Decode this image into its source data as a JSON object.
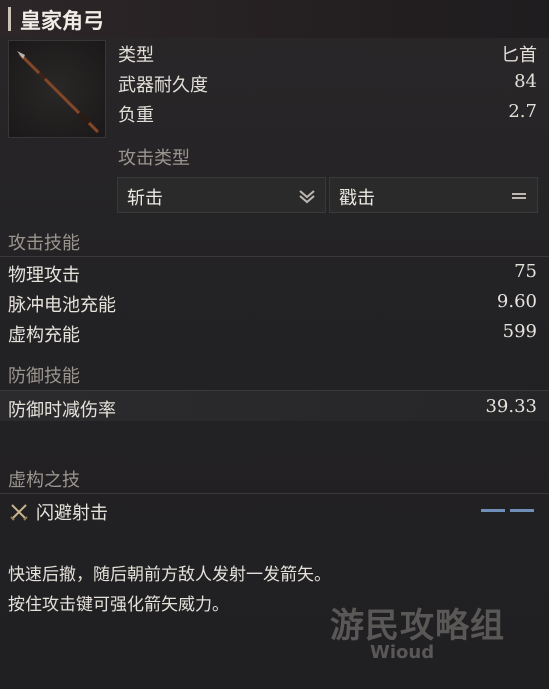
{
  "weapon": {
    "name": "皇家角弓",
    "icon": "spear-icon",
    "properties": [
      {
        "label": "类型",
        "value": "匕首"
      },
      {
        "label": "武器耐久度",
        "value": "84"
      },
      {
        "label": "负重",
        "value": "2.7"
      }
    ]
  },
  "attack_type": {
    "heading": "攻击类型",
    "primary": {
      "label": "斩击",
      "icon": "double-chevron-down-icon"
    },
    "secondary": {
      "label": "戳击",
      "icon": "equals-icon"
    }
  },
  "attack_skills": {
    "heading": "攻击技能",
    "rows": [
      {
        "label": "物理攻击",
        "value": "75"
      },
      {
        "label": "脉冲电池充能",
        "value": "9.60"
      },
      {
        "label": "虚构充能",
        "value": "599"
      }
    ]
  },
  "defense_skills": {
    "heading": "防御技能",
    "rows": [
      {
        "label": "防御时减伤率",
        "value": "39.33"
      }
    ]
  },
  "fable_art": {
    "heading": "虚构之技",
    "name": "闪避射击",
    "icon": "crossed-swords-icon",
    "cost_bars": 2,
    "cost_color": "#6f8fb8"
  },
  "description": {
    "line1": "快速后撤，随后朝前方敌人发射一发箭矢。",
    "line2": "按住攻击键可强化箭矢威力。"
  },
  "watermark": {
    "title": "游民攻略组",
    "subtitle": "Wioud"
  }
}
